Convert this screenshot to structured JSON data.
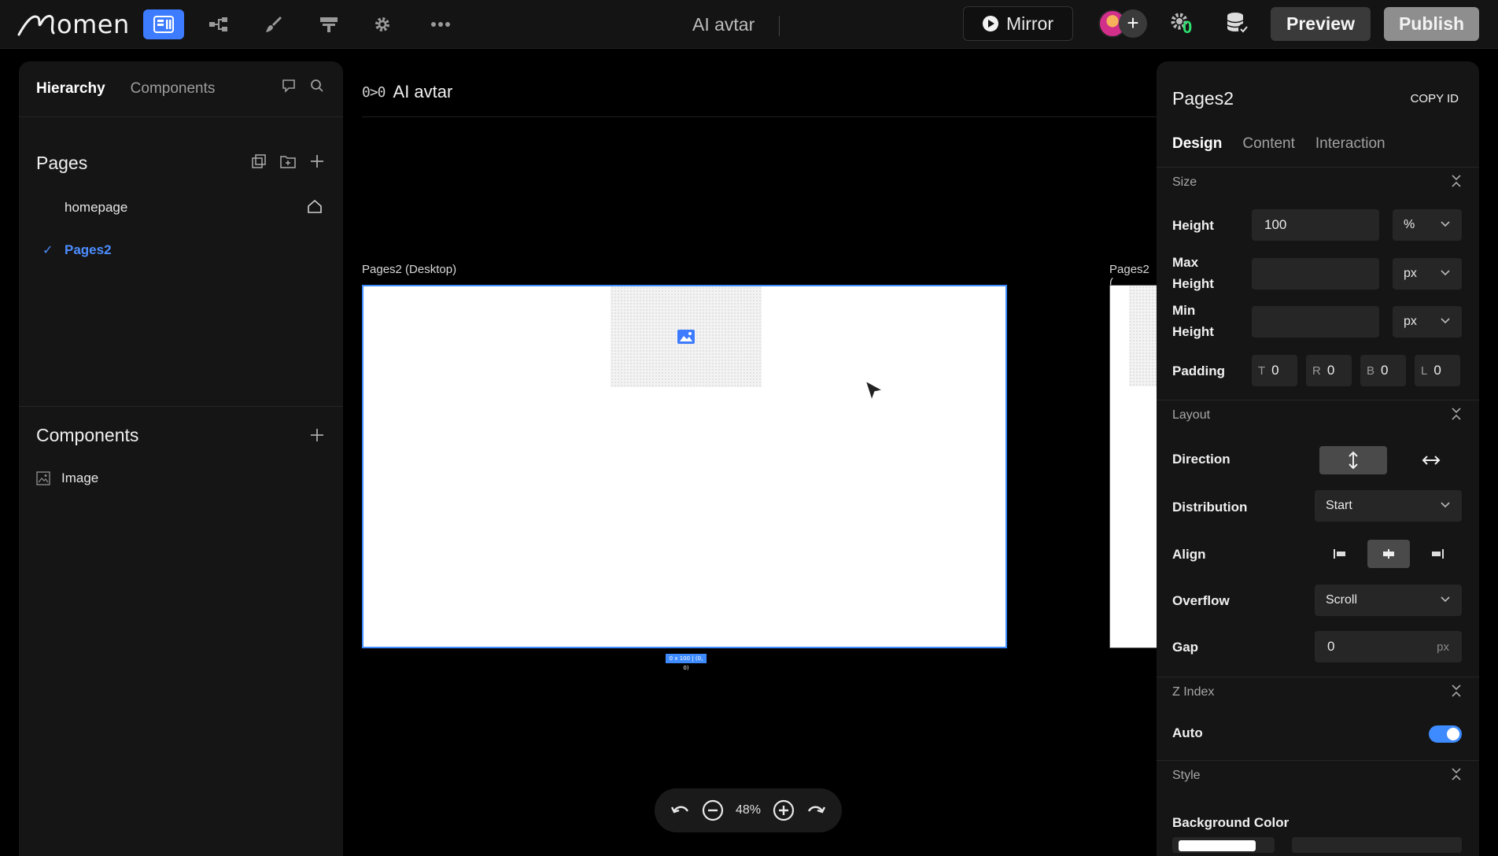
{
  "topbar": {
    "logo_text": "omen",
    "doc_title": "AI avtar",
    "mirror_label": "Mirror",
    "avatar_add": "+",
    "plugin_count": "0",
    "preview_label": "Preview",
    "publish_label": "Publish",
    "icons": [
      "layout-icon",
      "flow-icon",
      "brush-icon",
      "layers-icon",
      "gear-icon",
      "more-icon"
    ]
  },
  "left_panel": {
    "tabs": [
      "Hierarchy",
      "Components"
    ],
    "pages_title": "Pages",
    "pages": [
      {
        "label": "homepage",
        "home": true,
        "selected": false
      },
      {
        "label": "Pages2",
        "home": false,
        "selected": true
      }
    ],
    "components_title": "Components",
    "components": [
      {
        "label": "Image"
      }
    ]
  },
  "canvas": {
    "breadcrumb_icon": "0>0",
    "breadcrumb": "AI avtar",
    "frame_label": "Pages2 (Desktop)",
    "frame2_label": "Pages2 (",
    "size_tag": "0 x 100 | (0, 0)",
    "zoom": "48%"
  },
  "right_panel": {
    "title": "Pages2",
    "copy_id": "COPY ID",
    "tabs": [
      "Design",
      "Content",
      "Interaction"
    ],
    "size": {
      "section": "Size",
      "height_label": "Height",
      "height_value": "100",
      "height_unit": "%",
      "max_height_label_1": "Max",
      "max_height_label_2": "Height",
      "max_height_unit": "px",
      "min_height_label_1": "Min",
      "min_height_label_2": "Height",
      "min_height_unit": "px",
      "padding_label": "Padding",
      "padding": [
        {
          "key": "T",
          "value": "0"
        },
        {
          "key": "R",
          "value": "0"
        },
        {
          "key": "B",
          "value": "0"
        },
        {
          "key": "L",
          "value": "0"
        }
      ]
    },
    "layout": {
      "section": "Layout",
      "direction_label": "Direction",
      "distribution_label": "Distribution",
      "distribution_value": "Start",
      "align_label": "Align",
      "overflow_label": "Overflow",
      "overflow_value": "Scroll",
      "gap_label": "Gap",
      "gap_value": "0",
      "gap_unit": "px"
    },
    "zindex": {
      "section": "Z Index",
      "auto_label": "Auto",
      "auto_on": true
    },
    "style": {
      "section": "Style",
      "bg_label": "Background Color"
    }
  },
  "colors": {
    "accent": "#3d8bff",
    "panel": "#151515",
    "field": "#262626",
    "badge_green": "#2ee06f"
  }
}
